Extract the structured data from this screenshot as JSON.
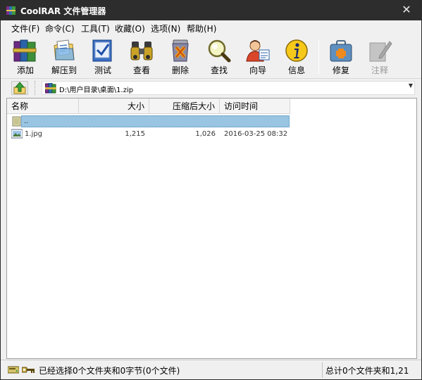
{
  "window": {
    "title": "CoolRAR 文件管理器",
    "close_glyph": "✕"
  },
  "menu": [
    {
      "label": "文件(F)"
    },
    {
      "label": "命令(C)"
    },
    {
      "label": "工具(T)"
    },
    {
      "label": "收藏(O)"
    },
    {
      "label": "选项(N)"
    },
    {
      "label": "帮助(H)"
    }
  ],
  "toolbar": [
    {
      "label": "添加",
      "icon": "books-add-icon",
      "enabled": true
    },
    {
      "label": "解压到",
      "icon": "extract-folder-icon",
      "enabled": true
    },
    {
      "label": "测试",
      "icon": "test-check-icon",
      "enabled": true
    },
    {
      "label": "查看",
      "icon": "binoculars-icon",
      "enabled": true
    },
    {
      "label": "删除",
      "icon": "delete-trash-icon",
      "enabled": true
    },
    {
      "label": "查找",
      "icon": "magnifier-icon",
      "enabled": true
    },
    {
      "label": "向导",
      "icon": "wizard-person-icon",
      "enabled": true
    },
    {
      "label": "信息",
      "icon": "info-icon",
      "enabled": true
    },
    {
      "label": "修复",
      "icon": "repair-kit-icon",
      "enabled": true
    },
    {
      "label": "注释",
      "icon": "comment-icon",
      "enabled": false
    }
  ],
  "address": {
    "path": "D:\\用户目录\\桌面\\1.zip",
    "dropdown_glyph": "▼"
  },
  "columns": {
    "name": "名称",
    "size": "大小",
    "packed": "压缩后大小",
    "accessed": "访问时间"
  },
  "files": [
    {
      "name": "..",
      "size": "",
      "packed": "",
      "accessed": "",
      "icon": "parent-folder-icon",
      "selected": true
    },
    {
      "name": "1.jpg",
      "size": "1,215",
      "packed": "1,026",
      "accessed": "2016-03-25 08:32",
      "icon": "image-file-icon",
      "selected": false
    }
  ],
  "status": {
    "left": "已经选择0个文件夹和0字节(0个文件)",
    "right": "总计0个文件夹和1,21"
  },
  "colors": {
    "titlebar": "#2d2d2d",
    "selection": "#99c5e2",
    "window_bg": "#f0f0f0"
  }
}
